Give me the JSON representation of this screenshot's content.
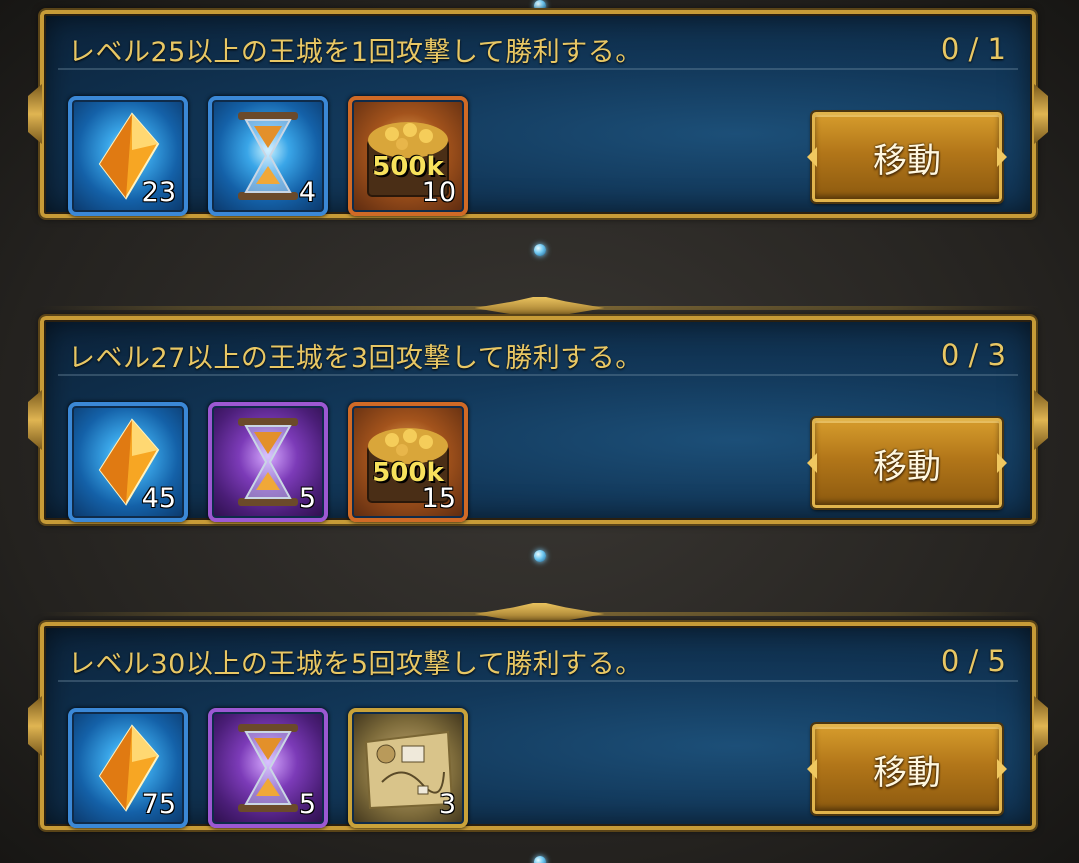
{
  "quests": [
    {
      "title": "レベル25以上の王城を1回攻撃して勝利する。",
      "progress": "0 / 1",
      "move_label": "移動",
      "rewards": [
        {
          "type": "gem",
          "icon": "crystal-icon",
          "frame": "blue",
          "count": "23"
        },
        {
          "type": "speedup",
          "icon": "hourglass-icon",
          "frame": "blue",
          "count": "4"
        },
        {
          "type": "resource",
          "icon": "gold-chest-icon",
          "frame": "orange",
          "label": "500k",
          "count": "10"
        }
      ]
    },
    {
      "title": "レベル27以上の王城を3回攻撃して勝利する。",
      "progress": "0 / 3",
      "move_label": "移動",
      "rewards": [
        {
          "type": "gem",
          "icon": "crystal-icon",
          "frame": "blue",
          "count": "45"
        },
        {
          "type": "speedup",
          "icon": "hourglass-icon",
          "frame": "purple",
          "count": "5"
        },
        {
          "type": "resource",
          "icon": "gold-chest-icon",
          "frame": "orange",
          "label": "500k",
          "count": "15"
        }
      ]
    },
    {
      "title": "レベル30以上の王城を5回攻撃して勝利する。",
      "progress": "0 / 5",
      "move_label": "移動",
      "rewards": [
        {
          "type": "gem",
          "icon": "crystal-icon",
          "frame": "blue",
          "count": "75"
        },
        {
          "type": "speedup",
          "icon": "hourglass-icon",
          "frame": "purple",
          "count": "5"
        },
        {
          "type": "item",
          "icon": "map-blueprint-icon",
          "frame": "gold",
          "count": "3"
        }
      ]
    }
  ],
  "colors": {
    "title_gold": "#e8c764",
    "frame_gold": "#c79b37",
    "panel_blue": "#12385a",
    "button_gold": "#b27619"
  }
}
